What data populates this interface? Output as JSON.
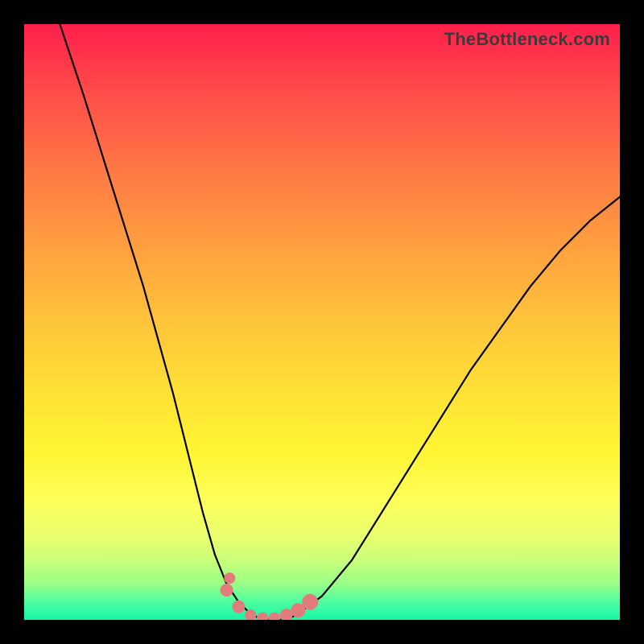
{
  "attribution": "TheBottleneck.com",
  "colors": {
    "frame": "#000000",
    "gradient_top": "#ff1f4b",
    "gradient_bottom": "#17f5a6",
    "curve": "#000000",
    "markers": "#e27b7b"
  },
  "chart_data": {
    "type": "line",
    "title": "",
    "xlabel": "",
    "ylabel": "",
    "xlim": [
      0,
      100
    ],
    "ylim": [
      0,
      100
    ],
    "series": [
      {
        "name": "bottleneck-curve",
        "x": [
          6,
          10,
          15,
          20,
          25,
          28,
          30,
          32,
          34,
          36,
          38,
          40,
          42,
          44,
          46,
          50,
          55,
          60,
          65,
          70,
          75,
          80,
          85,
          90,
          95,
          100
        ],
        "y": [
          100,
          88,
          72,
          56,
          38,
          26,
          18,
          11,
          6,
          3,
          1,
          0,
          0,
          0,
          1,
          4,
          10,
          18,
          26,
          34,
          42,
          49,
          56,
          62,
          67,
          71
        ]
      }
    ],
    "markers": {
      "name": "highlight-dots",
      "x": [
        34,
        36,
        38,
        40,
        42,
        44,
        46,
        48,
        34.5
      ],
      "y": [
        5,
        2.2,
        0.8,
        0.3,
        0.3,
        0.8,
        1.6,
        3.0,
        7
      ],
      "r": [
        8,
        8,
        7,
        7,
        7,
        8,
        9,
        10,
        7
      ]
    },
    "annotations": []
  }
}
